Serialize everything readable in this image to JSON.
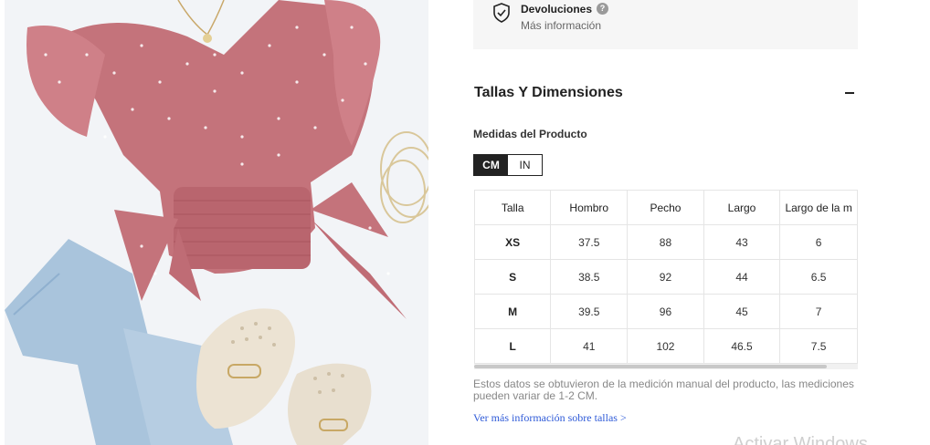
{
  "product_image": {
    "alt": "Blusa rosa de lunares con volantes"
  },
  "returns": {
    "title": "Devoluciones",
    "help_glyph": "?",
    "link": "Más información",
    "icon": "shield-check-icon"
  },
  "size_section": {
    "title": "Tallas Y Dimensiones",
    "subtitle": "Medidas del Producto",
    "units": [
      "CM",
      "IN"
    ],
    "active_unit": "CM",
    "table": {
      "headers": [
        "Talla",
        "Hombro",
        "Pecho",
        "Largo",
        "Largo de la m"
      ],
      "rows": [
        [
          "XS",
          "37.5",
          "88",
          "43",
          "6"
        ],
        [
          "S",
          "38.5",
          "92",
          "44",
          "6.5"
        ],
        [
          "M",
          "39.5",
          "96",
          "45",
          "7"
        ],
        [
          "L",
          "41",
          "102",
          "46.5",
          "7.5"
        ]
      ]
    },
    "note": "Estos datos se obtuvieron de la medición manual del producto, las mediciones pueden variar de 1-2 CM.",
    "more_link": "Ver más información sobre tallas >"
  },
  "watermark": "Activar Windows",
  "colors": {
    "accent_dark": "#222222",
    "link_blue": "#2f5bd8",
    "garment_pink": "#c4737b"
  }
}
